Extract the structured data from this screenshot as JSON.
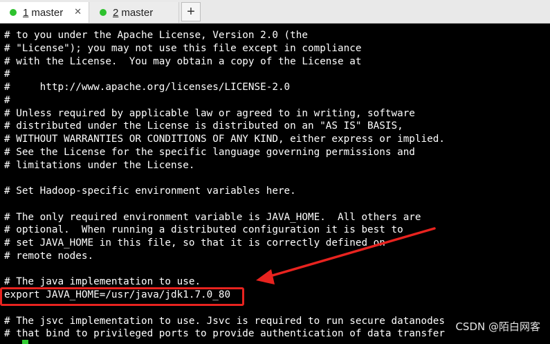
{
  "tabs": [
    {
      "number": "1",
      "label": "master",
      "active": true,
      "dot_color": "#2ec22e",
      "close": "✕"
    },
    {
      "number": "2",
      "label": "master",
      "active": false,
      "dot_color": "#2ec22e"
    }
  ],
  "new_tab_symbol": "+",
  "terminal": {
    "lines": [
      "# to you under the Apache License, Version 2.0 (the",
      "# \"License\"); you may not use this file except in compliance",
      "# with the License.  You may obtain a copy of the License at",
      "#",
      "#     http://www.apache.org/licenses/LICENSE-2.0",
      "#",
      "# Unless required by applicable law or agreed to in writing, software",
      "# distributed under the License is distributed on an \"AS IS\" BASIS,",
      "# WITHOUT WARRANTIES OR CONDITIONS OF ANY KIND, either express or implied.",
      "# See the License for the specific language governing permissions and",
      "# limitations under the License.",
      "",
      "# Set Hadoop-specific environment variables here.",
      "",
      "# The only required environment variable is JAVA_HOME.  All others are",
      "# optional.  When running a distributed configuration it is best to",
      "# set JAVA_HOME in this file, so that it is correctly defined on",
      "# remote nodes.",
      "",
      "# The java implementation to use.",
      "export JAVA_HOME=/usr/java/jdk1.7.0_80",
      "",
      "# The jsvc implementation to use. Jsvc is required to run secure datanodes",
      "# that bind to privileged ports to provide authentication of data transfer"
    ],
    "text_color": "#ffffff",
    "background": "#000000"
  },
  "annotation": {
    "color": "#e8231f"
  },
  "watermark": "CSDN @陌白网客"
}
